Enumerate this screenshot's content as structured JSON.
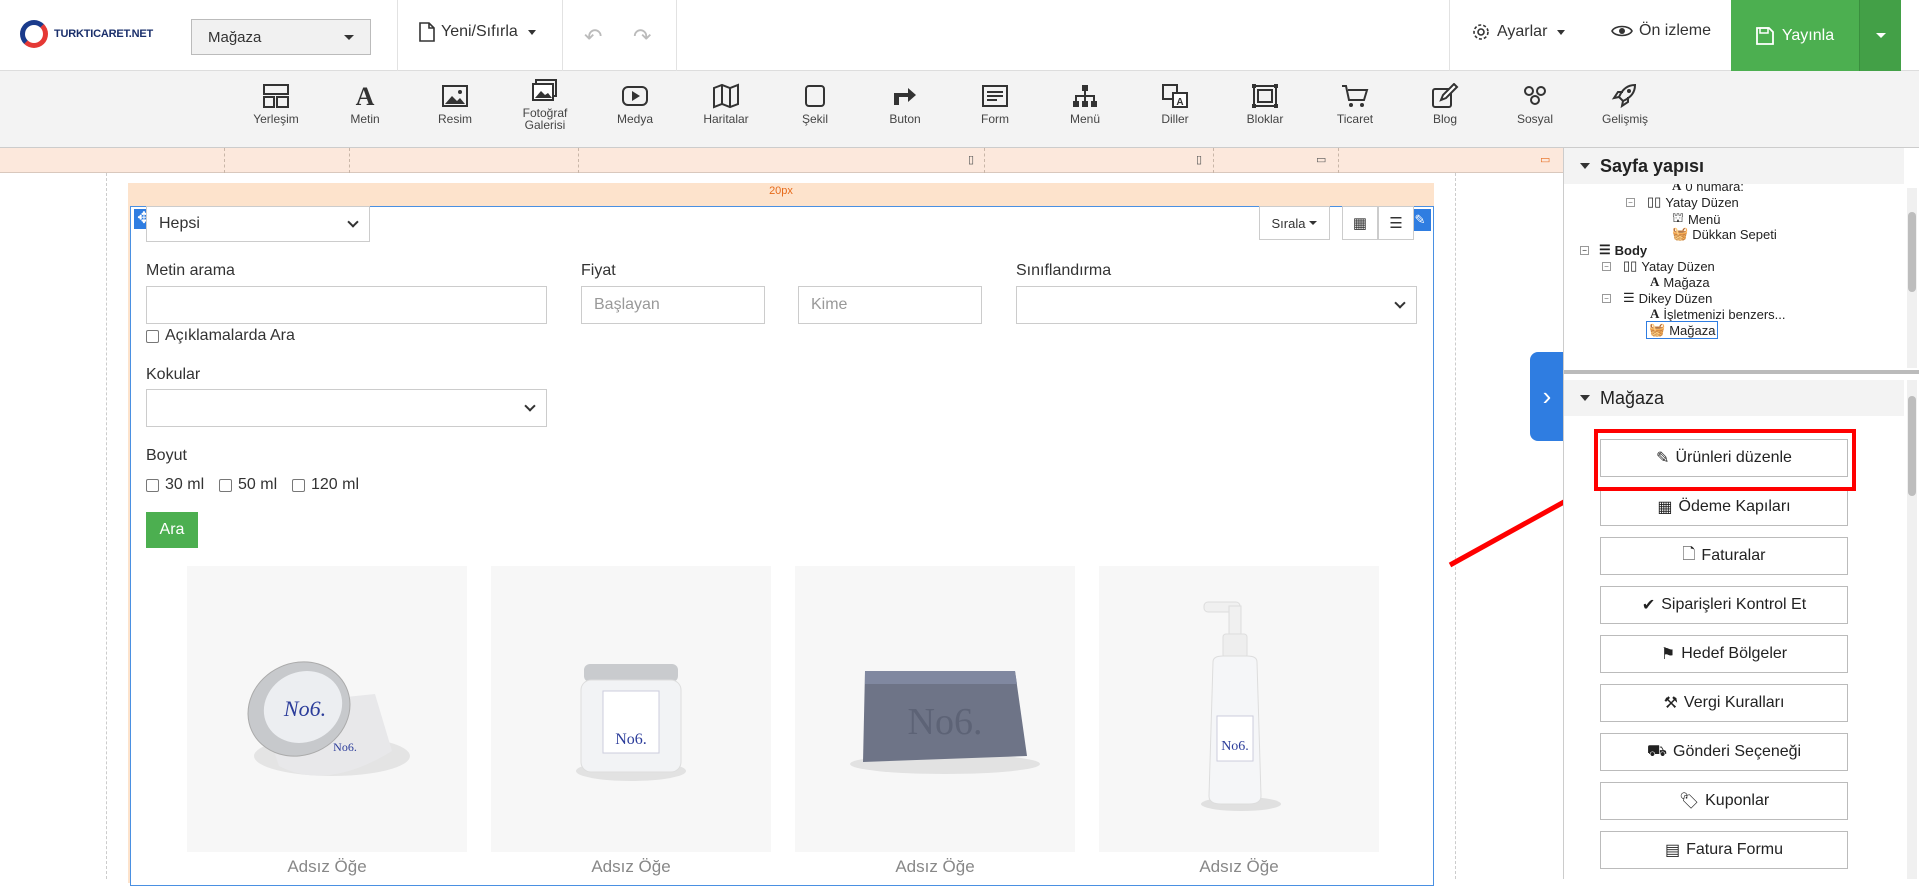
{
  "brand": {
    "name": "TURKTICARET.NET"
  },
  "header": {
    "store_select": "Mağaza",
    "new_reset": "Yeni/Sıfırla",
    "settings": "Ayarlar",
    "preview": "Ön izleme",
    "publish": "Yayınla"
  },
  "toolbar": {
    "items": [
      {
        "label": "Yerleşim",
        "icon": "layout-icon"
      },
      {
        "label": "Metin",
        "icon": "text-icon"
      },
      {
        "label": "Resim",
        "icon": "image-icon"
      },
      {
        "label": "Fotoğraf",
        "label2": "Galerisi",
        "icon": "gallery-icon"
      },
      {
        "label": "Medya",
        "icon": "media-icon"
      },
      {
        "label": "Haritalar",
        "icon": "map-icon"
      },
      {
        "label": "Şekil",
        "icon": "shape-icon"
      },
      {
        "label": "Buton",
        "icon": "button-icon"
      },
      {
        "label": "Form",
        "icon": "form-icon"
      },
      {
        "label": "Menü",
        "icon": "menu-icon"
      },
      {
        "label": "Diller",
        "icon": "languages-icon"
      },
      {
        "label": "Bloklar",
        "icon": "blocks-icon"
      },
      {
        "label": "Ticaret",
        "icon": "cart-icon"
      },
      {
        "label": "Blog",
        "icon": "blog-icon"
      },
      {
        "label": "Sosyal",
        "icon": "social-icon"
      },
      {
        "label": "Gelişmiş",
        "icon": "rocket-icon"
      }
    ]
  },
  "canvas": {
    "padding_label": "20px",
    "category_select": "Hepsi",
    "sort_label": "Sırala",
    "search": {
      "label": "Metin arama",
      "value": ""
    },
    "search_descriptions": "Açıklamalarda Ara",
    "price": {
      "label": "Fiyat",
      "from_placeholder": "Başlayan",
      "to_placeholder": "Kime"
    },
    "classification": {
      "label": "Sınıflandırma",
      "value": ""
    },
    "scents": {
      "label": "Kokular",
      "value": ""
    },
    "size": {
      "label": "Boyut",
      "options": [
        "30 ml",
        "50 ml",
        "120 ml"
      ]
    },
    "search_button": "Ara",
    "products": [
      {
        "name": "Adsız Öğe",
        "type": "tin-jar"
      },
      {
        "name": "Adsız Öğe",
        "type": "cream-jar"
      },
      {
        "name": "Adsız Öğe",
        "type": "soap-bar"
      },
      {
        "name": "Adsız Öğe",
        "type": "pump-bottle"
      }
    ]
  },
  "structure": {
    "title": "Sayfa yapısı",
    "nodes": [
      {
        "label": "0 numara:"
      },
      {
        "label": "Yatay Düzen"
      },
      {
        "label": "Menü"
      },
      {
        "label": "Dükkan Sepeti"
      },
      {
        "label": "Body"
      },
      {
        "label": "Yatay Düzen"
      },
      {
        "label": "Mağaza"
      },
      {
        "label": "Dikey Düzen"
      },
      {
        "label": "İşletmenizi benzers..."
      },
      {
        "label": "Mağaza"
      }
    ]
  },
  "store_panel": {
    "title": "Mağaza",
    "buttons": [
      {
        "label": "Ürünleri düzenle",
        "icon": "pencil-icon"
      },
      {
        "label": "Ödeme Kapıları",
        "icon": "grid-icon"
      },
      {
        "label": "Faturalar",
        "icon": "file-icon"
      },
      {
        "label": "Siparişleri Kontrol Et",
        "icon": "check-icon"
      },
      {
        "label": "Hedef Bölgeler",
        "icon": "signpost-icon"
      },
      {
        "label": "Vergi Kuralları",
        "icon": "gavel-icon"
      },
      {
        "label": "Gönderi Seçeneği",
        "icon": "truck-icon"
      },
      {
        "label": "Kuponlar",
        "icon": "tags-icon"
      },
      {
        "label": "Fatura Formu",
        "icon": "form-icon"
      }
    ]
  },
  "colors": {
    "accent": "#2f7de1",
    "publish": "#4caf50",
    "highlight": "#ff0000"
  }
}
